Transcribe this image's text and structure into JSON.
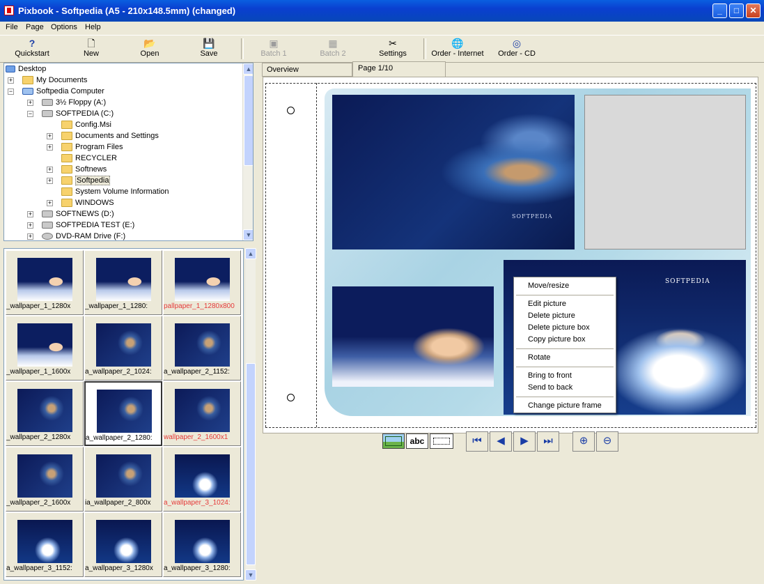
{
  "window": {
    "title": "Pixbook - Softpedia (A5 - 210x148.5mm) (changed)"
  },
  "menu": [
    "File",
    "Page",
    "Options",
    "Help"
  ],
  "toolbar": {
    "quickstart": "Quickstart",
    "new": "New",
    "open": "Open",
    "save": "Save",
    "batch1": "Batch 1",
    "batch2": "Batch 2",
    "settings": "Settings",
    "order_internet": "Order - Internet",
    "order_cd": "Order - CD"
  },
  "tree": [
    "Desktop",
    "My Documents",
    "Softpedia Computer",
    "3½ Floppy (A:)",
    "SOFTPEDIA (C:)",
    "Config.Msi",
    "Documents and Settings",
    "Program Files",
    "RECYCLER",
    "Softnews",
    "Softpedia",
    "System Volume Information",
    "WINDOWS",
    "SOFTNEWS (D:)",
    "SOFTPEDIA TEST (E:)",
    "DVD-RAM Drive (F:)"
  ],
  "thumbnails": [
    "_wallpaper_1_1280x",
    "_wallpaper_1_1280:",
    "pallpaper_1_1280x800",
    "_wallpaper_1_1600x",
    "a_wallpaper_2_1024:",
    "a_wallpaper_2_1152:",
    "_wallpaper_2_1280x",
    "a_wallpaper_2_1280:",
    "wallpaper_2_1600x1",
    "_wallpaper_2_1600x",
    "ia_wallpaper_2_800x",
    "a_wallpaper_3_1024:",
    "a_wallpaper_3_1152:",
    "a_wallpaper_3_1280x",
    "a_wallpaper_3_1280:"
  ],
  "tabs": {
    "overview": "Overview",
    "page": "Page 1/10"
  },
  "context_menu": [
    "Move/resize",
    "Edit picture",
    "Delete picture",
    "Delete picture box",
    "Copy picture box",
    "Rotate",
    "Bring to front",
    "Send to back",
    "Change picture frame"
  ],
  "photo_text": {
    "brand": "SOFTPEDIA"
  },
  "tools": {
    "text_tool": "abc"
  }
}
